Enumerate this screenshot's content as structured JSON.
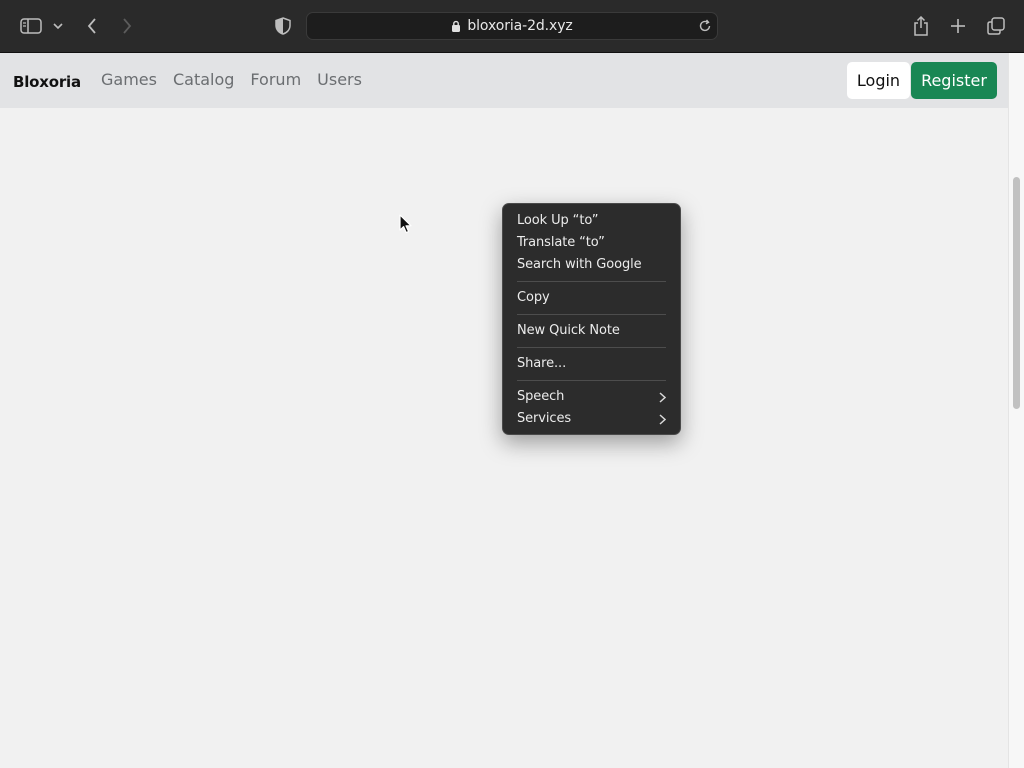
{
  "browser": {
    "url": "bloxoria-2d.xyz"
  },
  "navbar": {
    "brand": "Bloxoria",
    "links": [
      "Games",
      "Catalog",
      "Forum",
      "Users"
    ],
    "login_label": "Login",
    "register_label": "Register"
  },
  "context_menu": {
    "items": [
      {
        "label": "Look Up “to”"
      },
      {
        "label": "Translate “to”"
      },
      {
        "label": "Search with Google"
      },
      {
        "label": "Copy"
      },
      {
        "label": "New Quick Note"
      },
      {
        "label": "Share..."
      },
      {
        "label": "Speech"
      },
      {
        "label": "Services"
      }
    ]
  },
  "colors": {
    "register_accent": "#198754",
    "menu_bg": "#2c2c2c",
    "chrome_bg": "#2a2a2a"
  },
  "icons": [
    "sidebar-icon",
    "chevron-down-icon",
    "back-icon",
    "forward-icon",
    "shield-icon",
    "lock-icon",
    "reload-icon",
    "share-icon",
    "new-tab-icon",
    "tab-overview-icon",
    "cursor-icon"
  ]
}
